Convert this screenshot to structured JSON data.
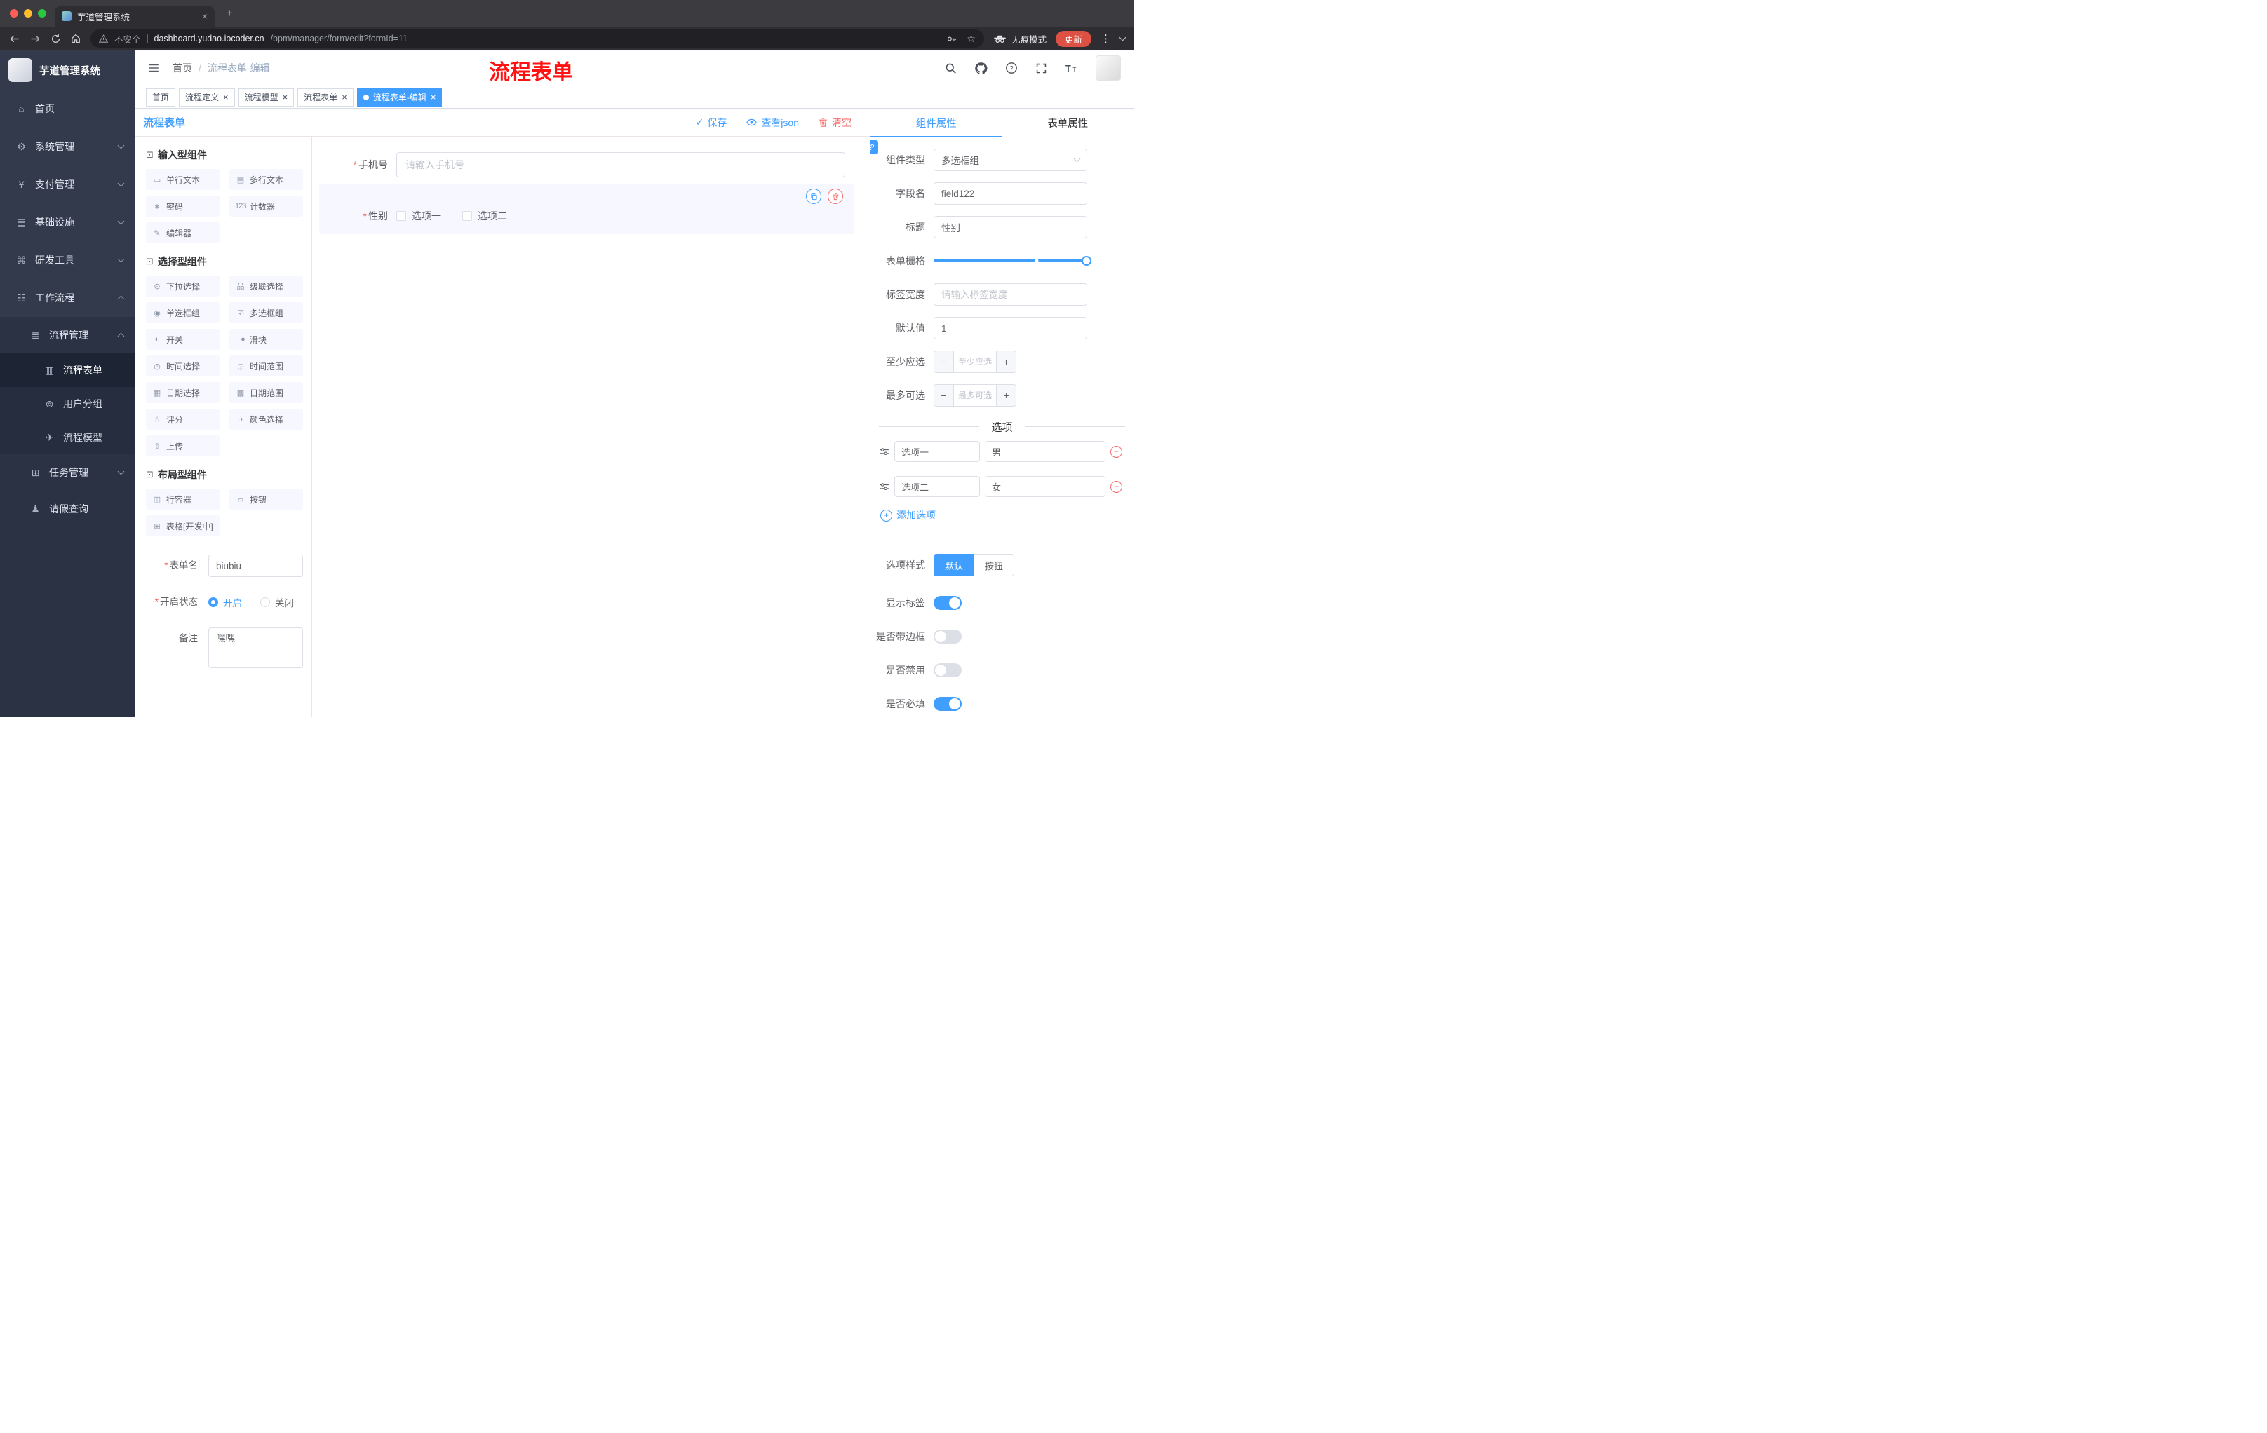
{
  "browser": {
    "tab_title": "芋道管理系统",
    "security_label": "不安全",
    "url_domain": "dashboard.yudao.iocoder.cn",
    "url_path": "/bpm/manager/form/edit?formId=11",
    "incognito_label": "无痕模式",
    "update_label": "更新"
  },
  "icons": {
    "close": "×",
    "plus": "+",
    "minus": "−",
    "check": "✓",
    "more_vertical": "⋮",
    "bookmark_star": "☆",
    "group_header": "⊡"
  },
  "sidebar": {
    "logo_title": "芋道管理系统",
    "items": [
      {
        "icon": "⌂",
        "label": "首页"
      },
      {
        "icon": "⚙",
        "label": "系统管理"
      },
      {
        "icon": "¥",
        "label": "支付管理"
      },
      {
        "icon": "▤",
        "label": "基础设施"
      },
      {
        "icon": "⌘",
        "label": "研发工具"
      },
      {
        "icon": "☷",
        "label": "工作流程"
      }
    ],
    "process_group": {
      "icon": "≣",
      "label": "流程管理",
      "children": [
        {
          "icon": "▥",
          "label": "流程表单"
        },
        {
          "icon": "⊚",
          "label": "用户分组"
        },
        {
          "icon": "✈",
          "label": "流程模型"
        }
      ]
    },
    "task_group": {
      "icon": "⊞",
      "label": "任务管理"
    },
    "leave_item": {
      "icon": "♟",
      "label": "请假查询"
    }
  },
  "header": {
    "breadcrumb_home": "首页",
    "breadcrumb_separator": "/",
    "breadcrumb_current": "流程表单-编辑",
    "annotation": "流程表单"
  },
  "tags": [
    {
      "label": "首页"
    },
    {
      "label": "流程定义"
    },
    {
      "label": "流程模型"
    },
    {
      "label": "流程表单"
    },
    {
      "label": "流程表单-编辑"
    }
  ],
  "designer": {
    "title": "流程表单",
    "save_label": "保存",
    "view_json_label": "查看json",
    "clear_label": "清空",
    "required_mark": "*",
    "palette_groups": [
      {
        "title": "输入型组件",
        "items": [
          {
            "icon": "▭",
            "label": "单行文本"
          },
          {
            "icon": "▤",
            "label": "多行文本"
          },
          {
            "icon": "∗",
            "label": "密码"
          },
          {
            "icon": "123",
            "label": "计数器"
          },
          {
            "icon": "✎",
            "label": "编辑器"
          }
        ]
      },
      {
        "title": "选择型组件",
        "items": [
          {
            "icon": "⊙",
            "label": "下拉选择"
          },
          {
            "icon": "品",
            "label": "级联选择"
          },
          {
            "icon": "◉",
            "label": "单选框组"
          },
          {
            "icon": "☑",
            "label": "多选框组"
          },
          {
            "icon": "◐",
            "label": "开关"
          },
          {
            "icon": "─●",
            "label": "滑块"
          },
          {
            "icon": "◷",
            "label": "时间选择"
          },
          {
            "icon": "◶",
            "label": "时间范围"
          },
          {
            "icon": "▦",
            "label": "日期选择"
          },
          {
            "icon": "▩",
            "label": "日期范围"
          },
          {
            "icon": "☆",
            "label": "评分"
          },
          {
            "icon": "◑",
            "label": "颜色选择"
          },
          {
            "icon": "⇧",
            "label": "上传"
          }
        ]
      },
      {
        "title": "布局型组件",
        "items": [
          {
            "icon": "◫",
            "label": "行容器"
          },
          {
            "icon": "▱",
            "label": "按钮"
          },
          {
            "icon": "⊞",
            "label": "表格[开发中]"
          }
        ]
      }
    ],
    "form_name_label": "表单名",
    "form_name_value": "biubiu",
    "status_label": "开启状态",
    "status_on": "开启",
    "status_off": "关闭",
    "remark_label": "备注",
    "remark_value": "嘿嘿",
    "canvas": {
      "phone_label": "手机号",
      "phone_placeholder": "请输入手机号",
      "gender_label": "性别",
      "gender_option1": "选项一",
      "gender_option2": "选项二"
    }
  },
  "properties": {
    "tab_component": "组件属性",
    "tab_form": "表单属性",
    "type_label": "组件类型",
    "type_value": "多选框组",
    "field_label": "字段名",
    "field_value": "field122",
    "title_label": "标题",
    "title_value": "性别",
    "grid_label": "表单栅格",
    "label_width_label": "标签宽度",
    "label_width_placeholder": "请输入标签宽度",
    "default_label": "默认值",
    "default_value": "1",
    "min_label": "至少应选",
    "min_placeholder": "至少应选",
    "max_label": "最多可选",
    "max_placeholder": "最多可选",
    "options_title": "选项",
    "options": [
      {
        "label": "选项一",
        "value": "男"
      },
      {
        "label": "选项二",
        "value": "女"
      }
    ],
    "add_option_label": "添加选项",
    "style_label": "选项样式",
    "style_default": "默认",
    "style_button": "按钮",
    "switch_show_label": "显示标签",
    "switch_border_label": "是否带边框",
    "switch_disabled_label": "是否禁用",
    "switch_required_label": "是否必填"
  },
  "colors": {
    "accent": "#409eff",
    "danger": "#f56c6c",
    "annotation": "#ff1212"
  }
}
